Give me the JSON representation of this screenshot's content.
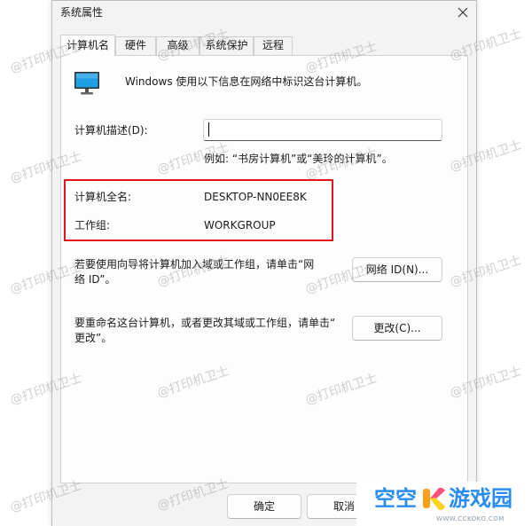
{
  "window": {
    "title": "系统属性",
    "close_icon": "close-icon"
  },
  "tabs": [
    {
      "label": "计算机名",
      "selected": true
    },
    {
      "label": "硬件",
      "selected": false
    },
    {
      "label": "高级",
      "selected": false
    },
    {
      "label": "系统保护",
      "selected": false
    },
    {
      "label": "远程",
      "selected": false
    }
  ],
  "computer_name": {
    "icon": "monitor-icon",
    "intro": "Windows 使用以下信息在网络中标识这台计算机。",
    "description": {
      "label": "计算机描述(D):",
      "value": "",
      "example": "例如: “书房计算机”或“美玲的计算机”。"
    },
    "full_name": {
      "label": "计算机全名:",
      "value": "DESKTOP-NN0EE8K"
    },
    "workgroup": {
      "label": "工作组:",
      "value": "WORKGROUP"
    },
    "network_id": {
      "text_lines": [
        "若要使用向导将计算机加入域或工作组，请单击“网",
        "络 ID”。"
      ],
      "button": "网络 ID(N)..."
    },
    "change": {
      "text_lines": [
        "要重命名这台计算机，或者更改其域或工作组，请单击“",
        "更改”。"
      ],
      "button": "更改(C)..."
    }
  },
  "footer": {
    "ok_button": "确定",
    "cancel_button": "取消"
  },
  "watermark": {
    "text": "@打印机卫士"
  },
  "logo": {
    "text_left": "空空",
    "icon": "k-logo-icon",
    "text_right": "游戏园",
    "site": "WWW.CCKOKO.COM"
  },
  "colors": {
    "highlight_box": "#e3141b",
    "logo_blue": "#2a8cf0",
    "screen_blue": "#1ea0e6",
    "dialog_bg": "#f3f3f3",
    "panel_bg": "#fdfdfd"
  }
}
